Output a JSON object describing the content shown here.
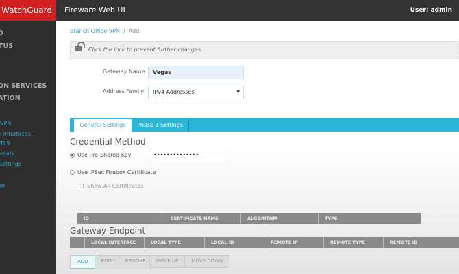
{
  "header": {
    "logo": "WatchGuard",
    "title": "Fireware Web UI",
    "user_label": "User:",
    "user": "admin"
  },
  "sidebar": {
    "top_items": [
      "D",
      "TUS",
      "ON SERVICES",
      "ATION"
    ],
    "sub_items": [
      "VPN",
      "l Interfaces",
      "TLS",
      "osals",
      " Settings",
      "gs"
    ]
  },
  "breadcrumb": {
    "parent": "Branch Office VPN",
    "current": "Add"
  },
  "lock_message": "Click the lock to prevent further changes",
  "form": {
    "gateway_name_label": "Gateway Name",
    "gateway_name": "Vegas",
    "address_family_label": "Address Family",
    "address_family": "IPv4 Addresses"
  },
  "tabs": [
    "General Settings",
    "Phase 1 Settings"
  ],
  "credential": {
    "title": "Credential Method",
    "psk_label": "Use Pre-Shared Key",
    "psk_value": "••••••••••••••",
    "cert_label": "Use IPSec Firebox Certificate",
    "show_all": "Show All Certificates",
    "columns": [
      "ID",
      "CERTIFICATE NAME",
      "ALGORITHM",
      "TYPE"
    ]
  },
  "endpoint": {
    "title": "Gateway Endpoint",
    "columns": [
      "",
      "LOCAL INTERFACE",
      "LOCAL TYPE",
      "LOCAL ID",
      "REMOTE IP",
      "REMOTE TYPE",
      "REMOTE ID"
    ]
  },
  "buttons": {
    "add": "ADD",
    "edit": "EDIT",
    "remove": "REMOVE",
    "move_up": "MOVE UP",
    "move_down": "MOVE DOWN"
  },
  "colors": {
    "brand": "#d21f1f",
    "accent": "#2bb5d6"
  }
}
